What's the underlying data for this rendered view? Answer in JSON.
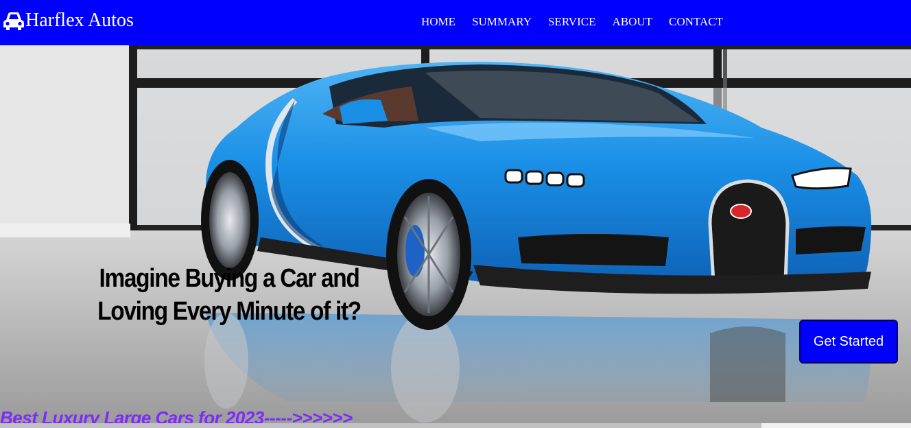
{
  "navbar": {
    "brand_icon": "car-icon",
    "brand_name": "Harflex Autos",
    "links": [
      "HOME",
      "SUMMARY",
      "SERVICE",
      "ABOUT",
      "CONTACT"
    ],
    "background": "#0000fe"
  },
  "hero": {
    "image": "blue-sports-car-showroom",
    "headline_line1": "Imagine Buying a Car and",
    "headline_line2": "Loving Every Minute of it?",
    "cta_label": "Get Started",
    "ticker": "Best Luxury Large Cars for 2023----->>>>>>"
  },
  "colors": {
    "accent": "#0000fe",
    "ticker": "#7b2cf5",
    "car_body": "#1a8fe6"
  }
}
